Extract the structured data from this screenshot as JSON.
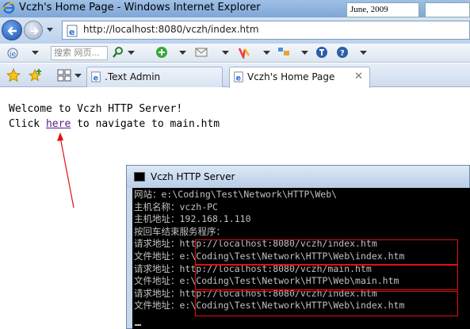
{
  "window": {
    "title": "Vczh's Home Page - Windows Internet Explorer",
    "date_box": "June, 2009"
  },
  "address_bar": {
    "url": "http://localhost:8080/vczh/index.htm"
  },
  "toolbar": {
    "search_placeholder": "搜索 网页..."
  },
  "tabs": [
    {
      "label": ".Text Admin",
      "active": false
    },
    {
      "label": "Vczh's Home Page",
      "active": true
    }
  ],
  "page": {
    "line1": "Welcome to Vczh HTTP Server!",
    "line2_before": "Click ",
    "link_text": "here",
    "line2_after": " to navigate to main.htm"
  },
  "console": {
    "title": "Vczh HTTP Server",
    "lines": [
      "网站：e:\\Coding\\Test\\Network\\HTTP\\Web\\",
      "主机名称：vczh-PC",
      "主机地址：192.168.1.110",
      "按回车结束服务程序：",
      "请求地址：http://localhost:8080/vczh/index.htm",
      "文件地址：e:\\Coding\\Test\\Network\\HTTP\\Web\\index.htm",
      "请求地址：http://localhost:8080/vczh/main.htm",
      "文件地址：e:\\Coding\\Test\\Network\\HTTP\\Web\\main.htm",
      "请求地址：http://localhost:8080/vczh/index.htm",
      "文件地址：e:\\Coding\\Test\\Network\\HTTP\\Web\\index.htm"
    ]
  },
  "colors": {
    "annotation_red": "#e01010",
    "visited_link": "#551a8b",
    "console_bg": "#000000",
    "console_text": "#c0c0c0"
  },
  "icons": {
    "back": "back-arrow-icon",
    "forward": "forward-arrow-icon",
    "page": "ie-page-icon",
    "favorites": "favorites-star-icon",
    "add_favorite": "add-favorite-icon",
    "quick_tabs": "quick-tabs-icon",
    "console": "cmd-icon"
  }
}
